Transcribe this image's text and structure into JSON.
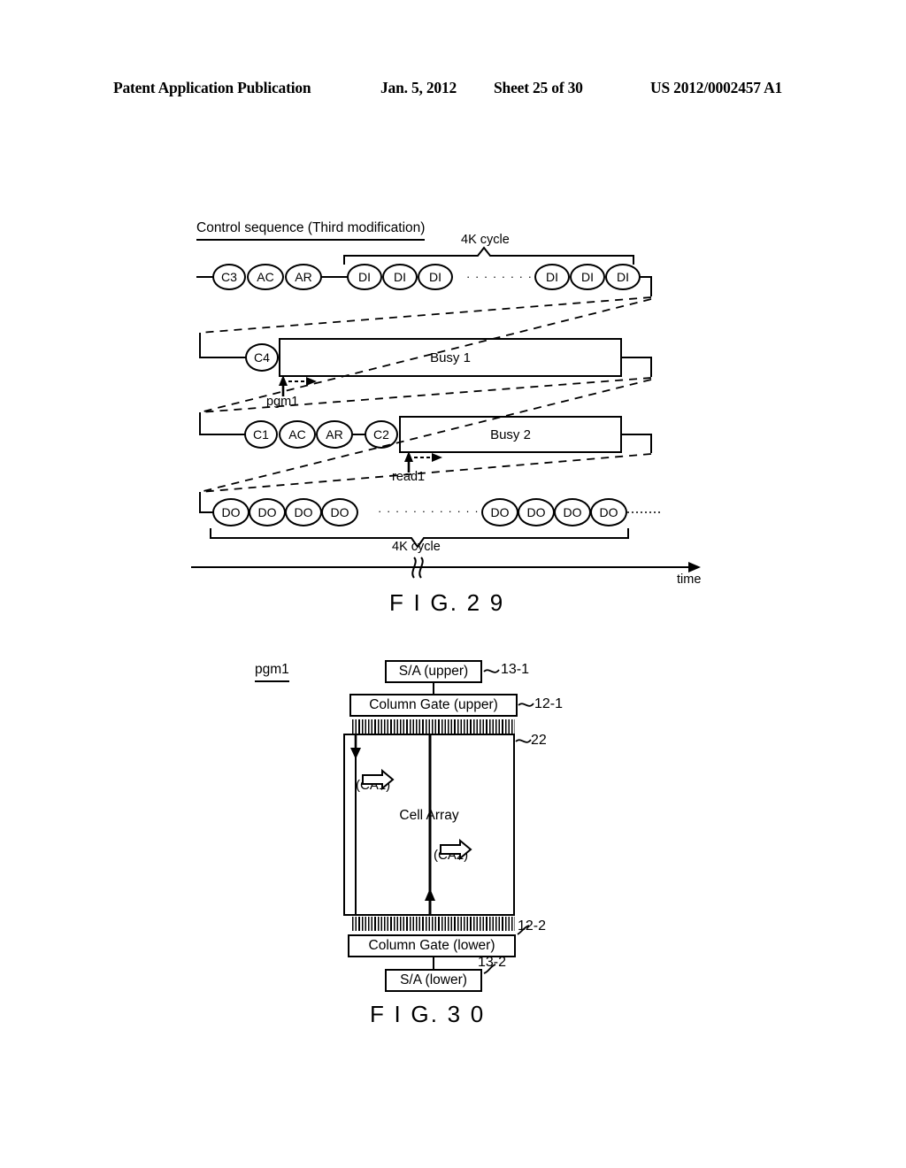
{
  "header": {
    "publication": "Patent Application Publication",
    "date": "Jan. 5, 2012",
    "sheet": "Sheet 25 of 30",
    "patent_number": "US 2012/0002457 A1"
  },
  "fig29": {
    "caption": "F I G. 2 9",
    "title": "Control sequence (Third modification)",
    "row1": {
      "name": "command-and-data-in-row",
      "left_ovals": [
        "C3",
        "AC",
        "AR"
      ],
      "di_group_left": [
        "DI",
        "DI",
        "DI"
      ],
      "di_group_right": [
        "DI",
        "DI",
        "DI"
      ],
      "ellipsis": "· · · · · · · · · ·",
      "bracket_label": "4K cycle"
    },
    "row2": {
      "name": "busy1-row",
      "oval": "C4",
      "box_label": "Busy 1",
      "arrow_label": "pgm1"
    },
    "row3": {
      "name": "busy2-row",
      "ovals": [
        "C1",
        "AC",
        "AR",
        "C2"
      ],
      "box_label": "Busy 2",
      "arrow_label": "read1"
    },
    "row4": {
      "name": "data-out-row",
      "do_group_left": [
        "DO",
        "DO",
        "DO",
        "DO"
      ],
      "do_group_right": [
        "DO",
        "DO",
        "DO",
        "DO"
      ],
      "ellipsis": "· · · · · · · · · · · · · ·",
      "bracket_label": "4K cycle"
    },
    "axis": {
      "label": "time",
      "break_symbol": "≈"
    }
  },
  "fig30": {
    "caption": "F I G. 3 0",
    "mode_label": "pgm1",
    "blocks": {
      "sa_upper": "S/A (upper)",
      "column_gate_upper": "Column Gate (upper)",
      "cell_array": "Cell Array",
      "column_gate_lower": "Column Gate  (lower)",
      "sa_lower": "S/A (lower)"
    },
    "refs": {
      "sa_upper": "13-1",
      "column_gate_upper": "12-1",
      "cell_array": "22",
      "column_gate_lower": "12-2",
      "sa_lower": "13-2"
    },
    "arrows": {
      "ca1": "(CA1)",
      "ca2": "(CA2)"
    }
  },
  "colors": {
    "ink": "#000000",
    "paper": "#ffffff"
  }
}
